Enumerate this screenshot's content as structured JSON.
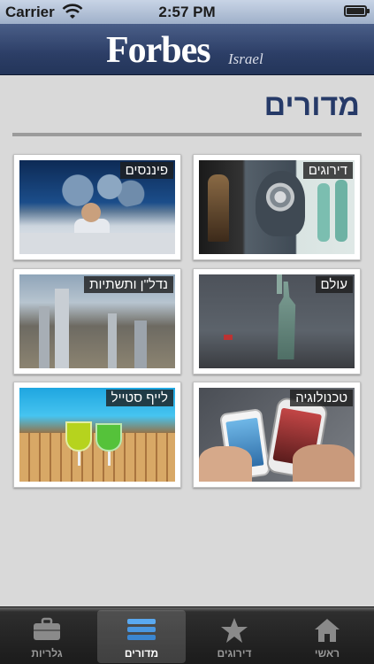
{
  "status_bar": {
    "carrier": "Carrier",
    "time": "2:57 PM"
  },
  "header": {
    "logo": "Forbes",
    "logo_sub": "Israel"
  },
  "page_title": "מדורים",
  "sections": [
    {
      "label": "דירוגים",
      "image": "ratings"
    },
    {
      "label": "פיננסים",
      "image": "finance"
    },
    {
      "label": "עולם",
      "image": "world"
    },
    {
      "label": "נדל\"ן ותשתיות",
      "image": "realestate"
    },
    {
      "label": "טכנולוגיה",
      "image": "tech"
    },
    {
      "label": "לייף סטייל",
      "image": "lifestyle"
    }
  ],
  "tabs": [
    {
      "label": "ראשי",
      "icon": "home-icon",
      "active": false
    },
    {
      "label": "דירוגים",
      "icon": "star-icon",
      "active": false
    },
    {
      "label": "מדורים",
      "icon": "list-icon",
      "active": true
    },
    {
      "label": "גלריות",
      "icon": "briefcase-icon",
      "active": false
    }
  ],
  "colors": {
    "header": "#2c3e66",
    "title": "#263a68",
    "tab_active_text": "#ffffff"
  }
}
